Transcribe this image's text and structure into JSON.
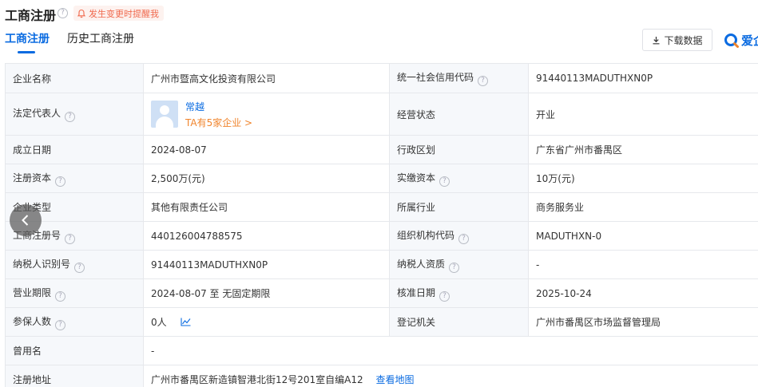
{
  "header": {
    "title": "工商注册",
    "help_glyph": "?",
    "remind_label": "发生变更时提醒我"
  },
  "tabs": [
    {
      "label": "工商注册",
      "active": true
    },
    {
      "label": "历史工商注册",
      "active": false
    }
  ],
  "toolbar": {
    "download_label": "下载数据",
    "brand_label": "爱企"
  },
  "info": {
    "company_name_label": "企业名称",
    "company_name": "广州市暨高文化投资有限公司",
    "credit_code_label": "统一社会信用代码",
    "credit_code": "91440113MADUTHXN0P",
    "legal_rep_label": "法定代表人",
    "legal_rep_name": "常越",
    "legal_rep_link": "TA有5家企业 >",
    "status_label": "经营状态",
    "status": "开业",
    "established_label": "成立日期",
    "established": "2024-08-07",
    "region_label": "行政区划",
    "region": "广东省广州市番禺区",
    "reg_capital_label": "注册资本",
    "reg_capital": "2,500万(元)",
    "paid_capital_label": "实缴资本",
    "paid_capital": "10万(元)",
    "company_type_label": "企业类型",
    "company_type": "其他有限责任公司",
    "industry_label": "所属行业",
    "industry": "商务服务业",
    "reg_number_label": "工商注册号",
    "reg_number": "440126004788575",
    "org_code_label": "组织机构代码",
    "org_code": "MADUTHXN-0",
    "taxpayer_id_label": "纳税人识别号",
    "taxpayer_id": "91440113MADUTHXN0P",
    "taxpayer_qual_label": "纳税人资质",
    "taxpayer_qual": "-",
    "term_label": "营业期限",
    "term": "2024-08-07 至 无固定期限",
    "approval_date_label": "核准日期",
    "approval_date": "2025-10-24",
    "insured_label": "参保人数",
    "insured": "0人",
    "authority_label": "登记机关",
    "authority": "广州市番禺区市场监督管理局",
    "former_name_label": "曾用名",
    "former_name": "-",
    "address_label": "注册地址",
    "address": "广州市番禺区新造镇智港北街12号201室自编A12",
    "map_link": "查看地图"
  },
  "colors": {
    "accent": "#0a6be1",
    "remind": "#f0694d",
    "link_orange": "#f0842c",
    "label_bg": "#f6f8fb"
  },
  "icons": {
    "remind": "bell-icon",
    "download": "download-icon",
    "brand": "brand-logo-icon",
    "trend": "trend-chart-icon",
    "back": "chevron-left-icon"
  }
}
